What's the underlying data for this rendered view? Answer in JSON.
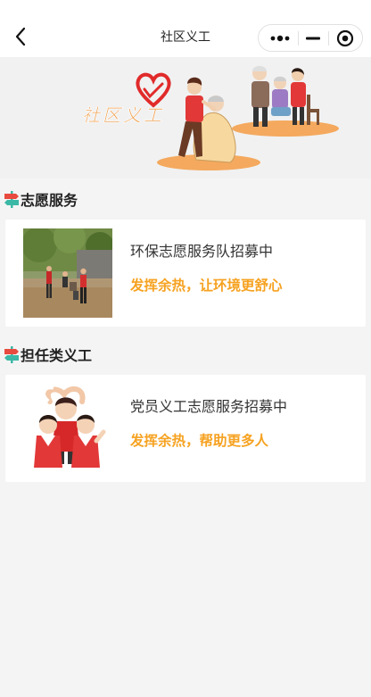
{
  "navbar": {
    "title": "社区义工",
    "back_icon": "chevron-left-icon",
    "capsule": {
      "more_icon": "more-dots-icon",
      "minimize_icon": "minus-icon",
      "close_icon": "target-circle-icon"
    }
  },
  "banner": {
    "logo_text": "社区义工",
    "logo_icon": "heart-hand-icon"
  },
  "sections": [
    {
      "title": "志愿服务",
      "icon": "signpost-icon",
      "items": [
        {
          "title": "环保志愿服务队招募中",
          "subtitle": "发挥余热，让环境更舒心",
          "image": "volunteers-outdoor-photo"
        }
      ]
    },
    {
      "title": "担任类义工",
      "icon": "signpost-icon",
      "items": [
        {
          "title": "党员义工志愿服务招募中",
          "subtitle": "发挥余热，帮助更多人",
          "image": "volunteers-cartoon-heart"
        }
      ]
    }
  ],
  "colors": {
    "accent_orange": "#f6a221",
    "signpost_red": "#e94a3f",
    "signpost_teal": "#3bb8a6"
  }
}
